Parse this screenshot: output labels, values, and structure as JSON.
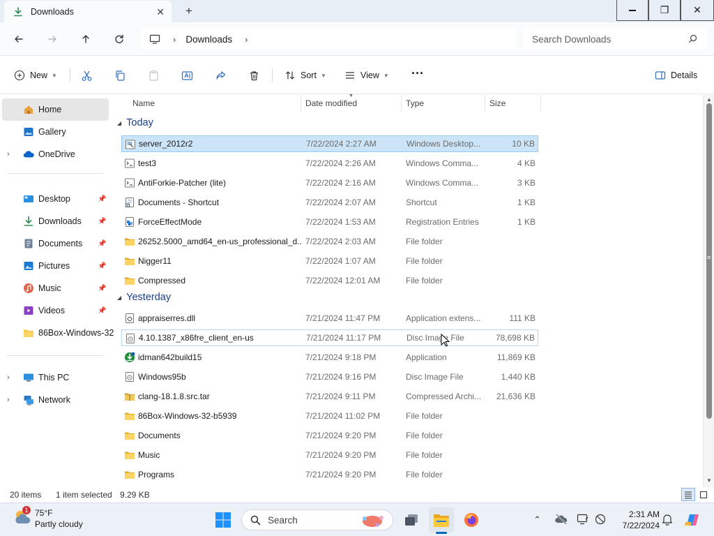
{
  "window": {
    "tab_title": "Downloads",
    "new_tab": "+",
    "controls": {
      "minimize": "—",
      "maximize": "❐",
      "close": "✕"
    }
  },
  "nav": {
    "breadcrumb": [
      "Downloads"
    ],
    "search_placeholder": "Search Downloads"
  },
  "toolbar": {
    "new_label": "New",
    "sort_label": "Sort",
    "view_label": "View",
    "more_label": "···",
    "details_label": "Details"
  },
  "sidebar": {
    "items": [
      {
        "label": "Home",
        "icon": "home-icon",
        "selected": true
      },
      {
        "label": "Gallery",
        "icon": "gallery-icon"
      },
      {
        "label": "OneDrive",
        "icon": "onedrive-icon",
        "expandable": true
      },
      {
        "label": "Desktop",
        "icon": "desktop-icon",
        "pinned": true
      },
      {
        "label": "Downloads",
        "icon": "downloads-icon",
        "pinned": true
      },
      {
        "label": "Documents",
        "icon": "documents-icon",
        "pinned": true
      },
      {
        "label": "Pictures",
        "icon": "pictures-icon",
        "pinned": true
      },
      {
        "label": "Music",
        "icon": "music-icon",
        "pinned": true
      },
      {
        "label": "Videos",
        "icon": "videos-icon",
        "pinned": true
      },
      {
        "label": "86Box-Windows-32",
        "icon": "folder-icon"
      },
      {
        "label": "This PC",
        "icon": "this-pc-icon",
        "expandable": true
      },
      {
        "label": "Network",
        "icon": "network-icon",
        "expandable": true
      }
    ]
  },
  "columns": {
    "name": "Name",
    "date": "Date modified",
    "type": "Type",
    "size": "Size"
  },
  "groups": [
    {
      "label": "Today",
      "files": [
        {
          "name": "server_2012r2",
          "date": "7/22/2024 2:27 AM",
          "type": "Windows Desktop...",
          "size": "10 KB",
          "icon": "rdp-file-icon",
          "selected": true
        },
        {
          "name": "test3",
          "date": "7/22/2024 2:26 AM",
          "type": "Windows Comma...",
          "size": "4 KB",
          "icon": "script-file-icon"
        },
        {
          "name": "AntiForkie-Patcher (lite)",
          "date": "7/22/2024 2:16 AM",
          "type": "Windows Comma...",
          "size": "3 KB",
          "icon": "script-file-icon"
        },
        {
          "name": "Documents - Shortcut",
          "date": "7/22/2024 2:07 AM",
          "type": "Shortcut",
          "size": "1 KB",
          "icon": "shortcut-icon"
        },
        {
          "name": "ForceEffectMode",
          "date": "7/22/2024 1:53 AM",
          "type": "Registration Entries",
          "size": "1 KB",
          "icon": "registry-file-icon"
        },
        {
          "name": "26252.5000_amd64_en-us_professional_d...",
          "date": "7/22/2024 2:03 AM",
          "type": "File folder",
          "size": "",
          "icon": "folder-icon"
        },
        {
          "name": "Nigger11",
          "date": "7/22/2024 1:07 AM",
          "type": "File folder",
          "size": "",
          "icon": "folder-icon"
        },
        {
          "name": "Compressed",
          "date": "7/22/2024 12:01 AM",
          "type": "File folder",
          "size": "",
          "icon": "folder-icon"
        }
      ]
    },
    {
      "label": "Yesterday",
      "files": [
        {
          "name": "appraiserres.dll",
          "date": "7/21/2024 11:47 PM",
          "type": "Application extens...",
          "size": "111 KB",
          "icon": "dll-file-icon"
        },
        {
          "name": "4.10.1387_x86fre_client_en-us",
          "date": "7/21/2024 11:17 PM",
          "type": "Disc Image File",
          "size": "78,698 KB",
          "icon": "disc-image-icon",
          "hover": true
        },
        {
          "name": "idman642build15",
          "date": "7/21/2024 9:18 PM",
          "type": "Application",
          "size": "11,869 KB",
          "icon": "application-icon"
        },
        {
          "name": "Windows95b",
          "date": "7/21/2024 9:16 PM",
          "type": "Disc Image File",
          "size": "1,440 KB",
          "icon": "disc-image-icon"
        },
        {
          "name": "clang-18.1.8.src.tar",
          "date": "7/21/2024 9:11 PM",
          "type": "Compressed Archi...",
          "size": "21,636 KB",
          "icon": "archive-icon"
        },
        {
          "name": "86Box-Windows-32-b5939",
          "date": "7/21/2024 11:02 PM",
          "type": "File folder",
          "size": "",
          "icon": "folder-icon"
        },
        {
          "name": "Documents",
          "date": "7/21/2024 9:20 PM",
          "type": "File folder",
          "size": "",
          "icon": "folder-icon"
        },
        {
          "name": "Music",
          "date": "7/21/2024 9:20 PM",
          "type": "File folder",
          "size": "",
          "icon": "folder-icon"
        },
        {
          "name": "Programs",
          "date": "7/21/2024 9:20 PM",
          "type": "File folder",
          "size": "",
          "icon": "folder-icon"
        }
      ]
    }
  ],
  "status": {
    "item_count": "20 items",
    "selection": "1 item selected",
    "selection_size": "9.29 KB"
  },
  "taskbar": {
    "weather_temp": "75°F",
    "weather_condition": "Partly cloudy",
    "weather_badge": "1",
    "search_label": "Search",
    "time": "2:31 AM",
    "date": "7/22/2024"
  },
  "colors": {
    "accent": "#0067c0",
    "selection_bg": "#cce4f7",
    "folder_yellow": "#f8c537",
    "group_header": "#1c3f8c"
  }
}
